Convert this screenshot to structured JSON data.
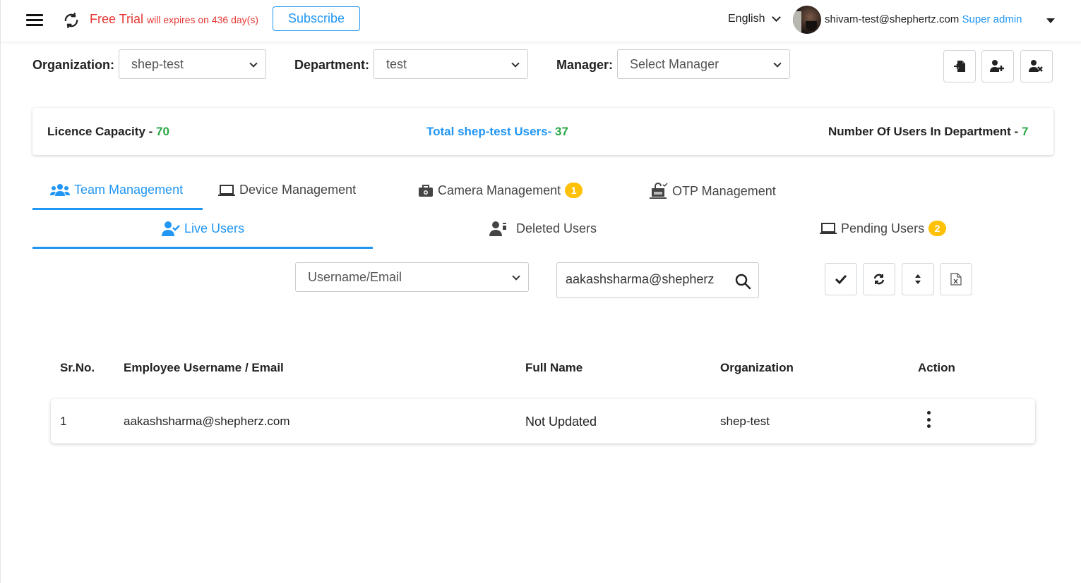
{
  "header": {
    "trial_title": "Free Trial",
    "trial_detail": "will expires on 436 day(s)",
    "subscribe_label": "Subscribe",
    "language": "English",
    "user_email": "shivam-test@shephertz.com",
    "user_role": "Super admin"
  },
  "filters": {
    "organization_label": "Organization:",
    "organization_value": "shep-test",
    "department_label": "Department:",
    "department_value": "test",
    "manager_label": "Manager:",
    "manager_value": "Select Manager"
  },
  "toolbar_icons": [
    "import-file-icon",
    "add-user-icon",
    "remove-user-icon"
  ],
  "stats": {
    "licence_label": "Licence Capacity - ",
    "licence_value": "70",
    "total_label": "Total shep-test Users- ",
    "total_value": "37",
    "dept_label": "Number Of Users In Department - ",
    "dept_value": "7"
  },
  "main_tabs": [
    {
      "label": "Team Management",
      "icon": "users-icon",
      "active": true
    },
    {
      "label": "Device Management",
      "icon": "laptop-icon"
    },
    {
      "label": "Camera Management",
      "icon": "camera-icon",
      "badge": "1"
    },
    {
      "label": "OTP Management",
      "icon": "otp-lock-icon"
    }
  ],
  "sub_tabs": [
    {
      "label": "Live Users",
      "icon": "user-check-icon",
      "active": true
    },
    {
      "label": "Deleted Users",
      "icon": "user-deleted-icon"
    },
    {
      "label": "Pending Users",
      "icon": "laptop-icon",
      "badge": "2"
    }
  ],
  "search": {
    "field_select": "Username/Email",
    "query": "aakashsharma@shepherz"
  },
  "action_icons": [
    "check-icon",
    "refresh-icon",
    "sort-icon",
    "excel-export-icon"
  ],
  "table": {
    "columns": [
      "Sr.No.",
      "Employee Username / Email",
      "Full Name",
      "Organization",
      "Action"
    ],
    "rows": [
      {
        "sr": "1",
        "email": "aakashsharma@shepherz.com",
        "full_name": "Not Updated",
        "organization": "shep-test"
      }
    ]
  },
  "colors": {
    "accent": "#2196f3",
    "trial_red": "#e53935",
    "count_green": "#28a745",
    "badge_yellow": "#ffc107"
  }
}
